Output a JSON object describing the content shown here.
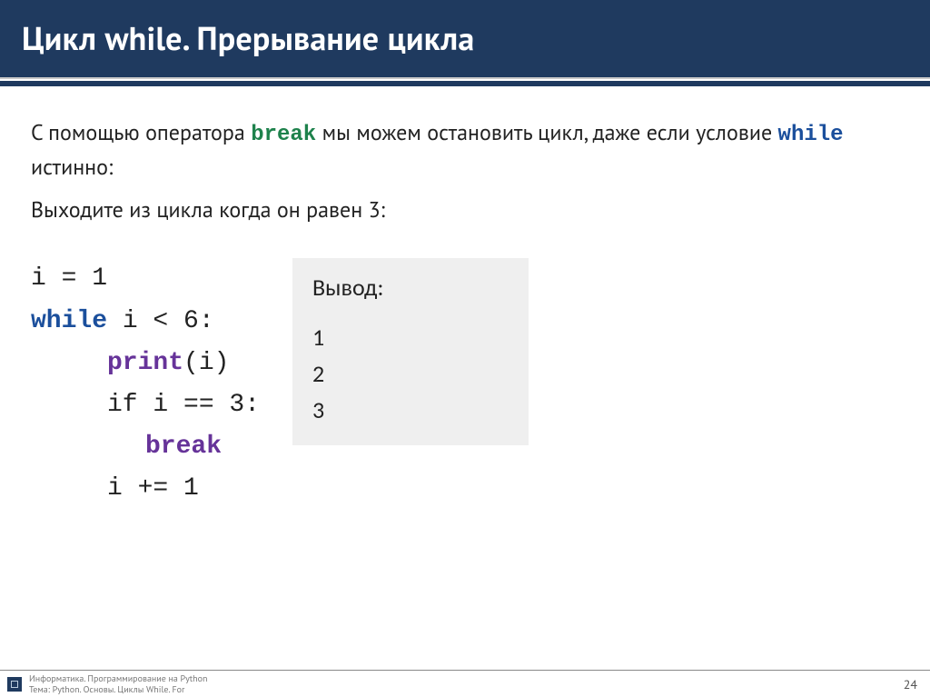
{
  "header": {
    "title": "Цикл while. Прерывание цикла"
  },
  "intro": {
    "part1a": "С помощью оператора ",
    "kw_break": "break",
    "part1b": " мы можем остановить цикл, даже если условие ",
    "kw_while": "while",
    "part1c": " истинно:",
    "line2": "Выходите из цикла когда он равен 3:"
  },
  "code": {
    "l1": "i = 1",
    "l2a": "while",
    "l2b": " i < 6:",
    "l3a": "print",
    "l3b": "(i)",
    "l4": "if i == 3:",
    "l5": "break",
    "l6": "i += 1"
  },
  "output": {
    "title": "Вывод:",
    "lines": [
      "1",
      "2",
      "3"
    ]
  },
  "footer": {
    "line1": "Информатика. Программирование на Python",
    "line2": "Тема: Python. Основы. Циклы While. For",
    "pagenum": "24"
  }
}
